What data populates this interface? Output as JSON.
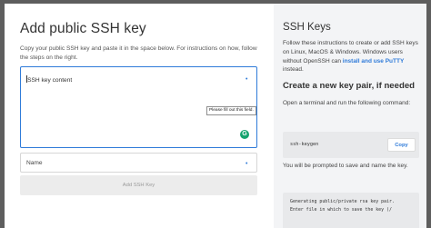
{
  "modal": {
    "title": "Add public SSH key",
    "description": "Copy your public SSH key and paste it in the space below. For instructions on how, follow the steps on the right.",
    "ssh_key_field": {
      "placeholder": "SSH key content",
      "required_marker": "•"
    },
    "tooltip": "Please fill out this field.",
    "grammarly_badge": "G",
    "name_field": {
      "placeholder": "Name",
      "required_marker": "•"
    },
    "submit_label": "Add SSH Key"
  },
  "help": {
    "title": "SSH Keys",
    "intro_text": "Follow these instructions to create or add SSH keys on Linux, MacOS & Windows. Windows users without OpenSSH can ",
    "intro_link": "install and use PuTTY",
    "intro_suffix": " instead.",
    "subheading": "Create a new key pair, if needed",
    "step_text": "Open a terminal and run the following command:",
    "command": "ssh-keygen",
    "copy_label": "Copy",
    "after_text": "You will be prompted to save and name the key.",
    "output_lines": "Generating public/private rsa key pair.\nEnter file in which to save the key (/"
  }
}
